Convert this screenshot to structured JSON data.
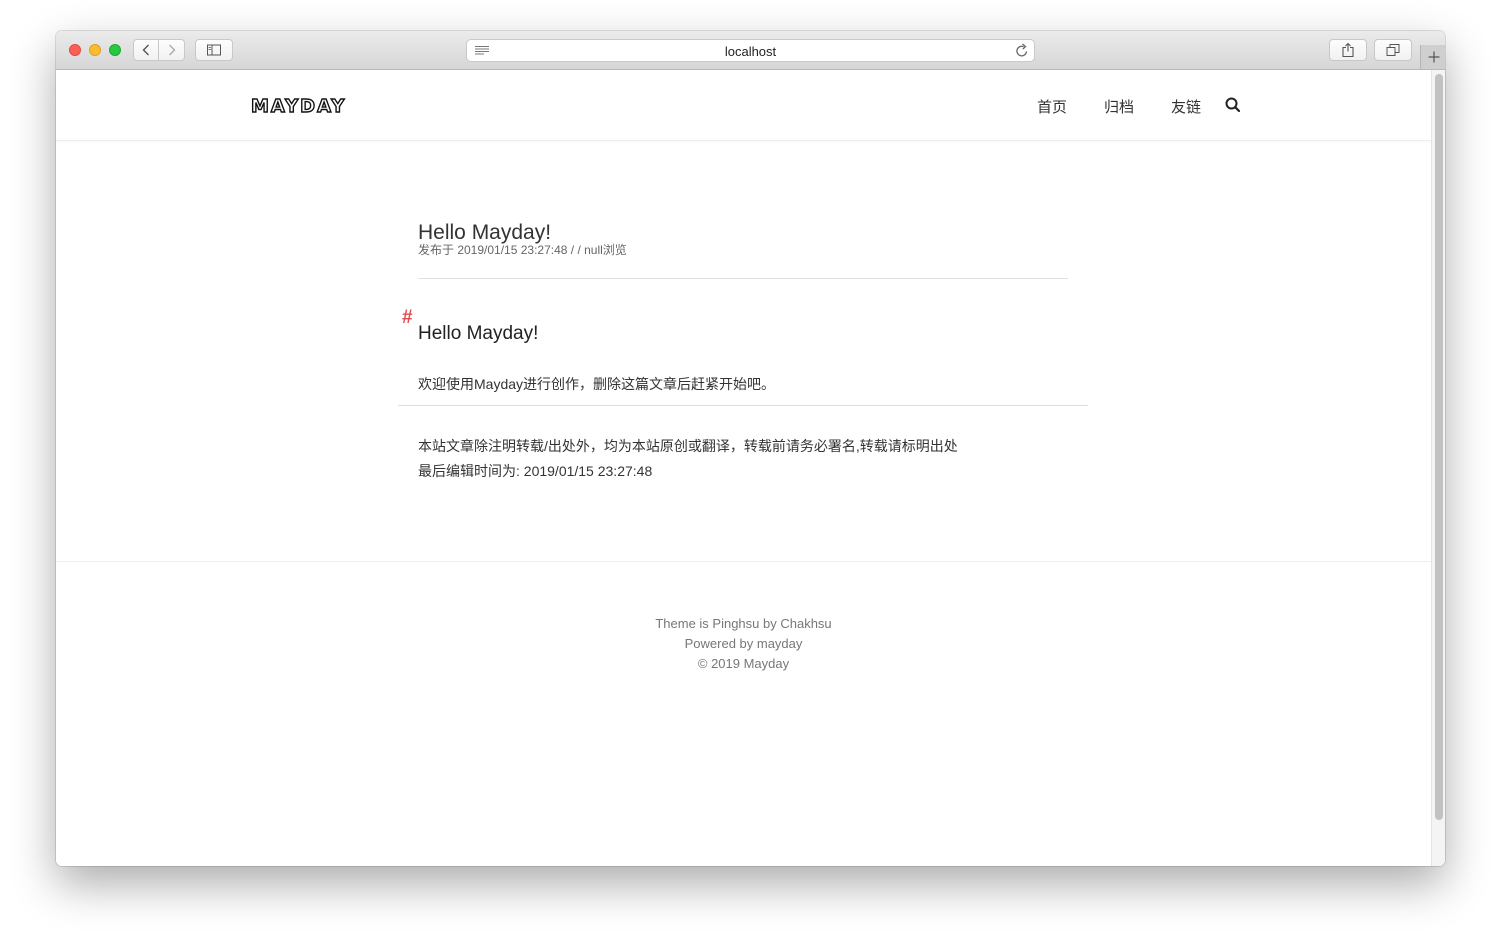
{
  "browser": {
    "url": "localhost"
  },
  "site": {
    "logo": "MAYDAY",
    "nav": {
      "home": "首页",
      "archive": "归档",
      "links": "友链"
    }
  },
  "post": {
    "title": "Hello Mayday!",
    "meta": "发布于 2019/01/15 23:27:48 / / null浏览",
    "heading_marker": "#",
    "heading": "Hello Mayday!",
    "body": "欢迎使用Mayday进行创作，删除这篇文章后赶紧开始吧。",
    "copyright_note": "本站文章除注明转载/出处外，均为本站原创或翻译，转载前请务必署名,转载请标明出处",
    "last_edited": "最后编辑时间为: 2019/01/15 23:27:48"
  },
  "footer": {
    "theme": "Theme is Pinghsu by Chakhsu",
    "powered": "Powered by mayday",
    "copyright": "© 2019 Mayday"
  },
  "colors": {
    "accent_hash": "#e24d4d",
    "text": "#333333"
  }
}
